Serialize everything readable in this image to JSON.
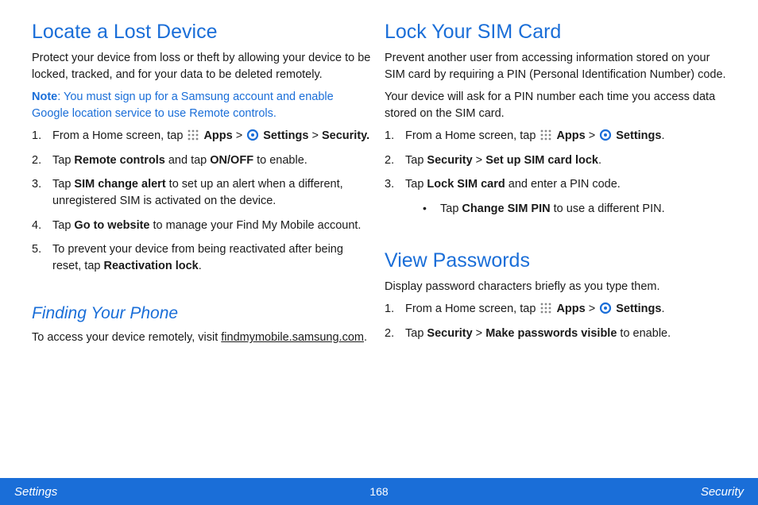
{
  "left": {
    "sec1": {
      "title": "Locate a Lost Device",
      "intro": "Protect your device from loss or theft by allowing your device to be locked, tracked, and for your data to be deleted remotely.",
      "note_label": "Note",
      "note_body": ": You must sign up for a Samsung account and enable Google location service to use Remote controls.",
      "s1_a": "From a Home screen, tap ",
      "s1_apps": "Apps",
      "s1_gt": " > ",
      "s1_settings": "Settings",
      "s1_c": " > ",
      "s1_security": "Security.",
      "s2_a": "Tap ",
      "s2_b": "Remote controls",
      "s2_c": " and tap ",
      "s2_d": "ON/OFF",
      "s2_e": " to enable.",
      "s3_a": "Tap ",
      "s3_b": "SIM change alert",
      "s3_c": " to set up an alert when a different, unregistered SIM is activated on the device.",
      "s4_a": "Tap ",
      "s4_b": "Go to website",
      "s4_c": " to manage your Find My Mobile account.",
      "s5_a": "To prevent your device from being reactivated after being reset, tap ",
      "s5_b": "Reactivation lock",
      "s5_c": "."
    },
    "sec2": {
      "title": "Finding Your Phone",
      "p_a": "To access your device remotely, visit ",
      "p_link": "findmymobile.samsung.com",
      "p_b": "."
    }
  },
  "right": {
    "sec1": {
      "title": "Lock Your SIM Card",
      "intro1": "Prevent another user from accessing information stored on your SIM card by requiring a PIN (Personal Identification Number) code.",
      "intro2": "Your device will ask for a PIN number each time you access data stored on the SIM card.",
      "s1_a": "From a Home screen, tap ",
      "s1_apps": "Apps",
      "s1_gt": " > ",
      "s1_settings": "Settings",
      "s1_c": ".",
      "s2_a": "Tap ",
      "s2_b": "Security",
      "s2_c": " > ",
      "s2_d": "Set up SIM card lock",
      "s2_e": ".",
      "s3_a": "Tap ",
      "s3_b": "Lock SIM card",
      "s3_c": " and enter a PIN code.",
      "bul_a": "Tap ",
      "bul_b": "Change SIM PIN",
      "bul_c": " to use a different PIN."
    },
    "sec2": {
      "title": "View Passwords",
      "intro": "Display password characters briefly as you type them.",
      "s1_a": "From a Home screen, tap ",
      "s1_apps": "Apps",
      "s1_gt": " > ",
      "s1_settings": "Settings",
      "s1_c": ".",
      "s2_a": "Tap ",
      "s2_b": "Security",
      "s2_c": " > ",
      "s2_d": "Make passwords visible",
      "s2_e": " to enable."
    }
  },
  "footer": {
    "left": "Settings",
    "center": "168",
    "right": "Security"
  }
}
